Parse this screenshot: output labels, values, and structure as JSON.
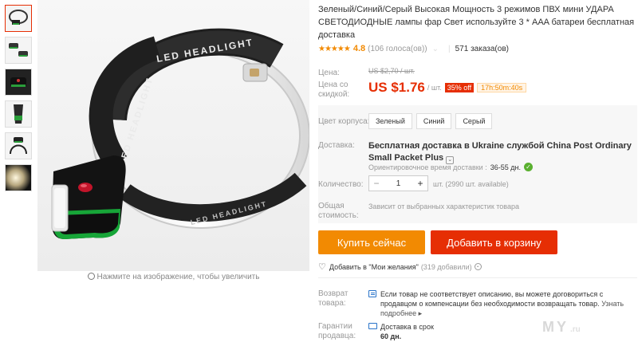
{
  "thumbnails": [
    {
      "name": "thumb-headlamp-1"
    },
    {
      "name": "thumb-headlamp-2"
    },
    {
      "name": "thumb-headlamp-3"
    },
    {
      "name": "thumb-headlamp-4"
    },
    {
      "name": "thumb-headlamp-5"
    },
    {
      "name": "thumb-headlamp-6"
    }
  ],
  "main_image": {
    "strap_text_1": "LED HEADLIGHT",
    "strap_text_2": "LED HEADLIGHT",
    "strap_text_3": "LED HEADLIGHT",
    "zoom_hint": "Нажмите на изображение, чтобы увеличить"
  },
  "product": {
    "title": "Зеленый/Синий/Серый Высокая Мощность 3 режимов ПВХ мини УДАРА СВЕТОДИОДНЫЕ лампы фар Свет используйте 3 * AAA батареи бесплатная доставка",
    "stars": "★★★★★",
    "rating": "4.8",
    "votes": "(106 голоса(ов))",
    "orders": "571 заказа(ов)"
  },
  "price": {
    "label": "Цена:",
    "old": "US $2,70 / шт.",
    "discount_label": "Цена со скидкой:",
    "current": "US $1.76",
    "unit": "/ шт.",
    "discount": "35% off",
    "timer": "17h:50m:40s"
  },
  "options": {
    "color_label": "Цвет корпуса:",
    "colors": [
      "Зеленый",
      "Синий",
      "Серый"
    ]
  },
  "shipping": {
    "label": "Доставка:",
    "main": "Бесплатная доставка в Ukraine службой China Post Ordinary Small Packet Plus",
    "eta_label": "Ориентировочное время доставки :",
    "eta_days": "36-55 дн."
  },
  "quantity": {
    "label": "Количество:",
    "minus": "−",
    "value": "1",
    "plus": "+",
    "available": "шт. (2990 шт. available)"
  },
  "total": {
    "label": "Общая стоимость:",
    "text": "Зависит от выбранных характеристик товара"
  },
  "buttons": {
    "buy": "Купить сейчас",
    "cart": "Добавить в корзину"
  },
  "wishlist": {
    "text": "Добавить в \"Мои желания\"",
    "count": "(319 добавили)"
  },
  "returns": {
    "label": "Возврат товара:",
    "text": "Если товар не соответствует описанию, вы можете договориться с продавцом о компенсации без необходимости возвращать товар.",
    "link": "Узнать подробнее ▸"
  },
  "guarantee": {
    "label": "Гарантии продавца:",
    "line1": "Доставка в срок",
    "line2": "60 дн."
  },
  "watermark": {
    "main": "MY",
    "suffix": ".ru"
  },
  "colors": {
    "accent_red": "#e62e04",
    "accent_orange": "#f28a02",
    "rating": "#f28a02"
  }
}
